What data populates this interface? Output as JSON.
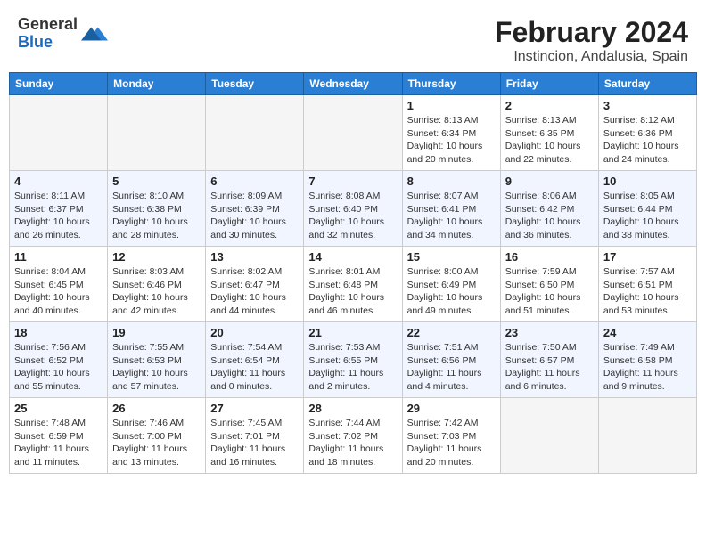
{
  "header": {
    "logo_general": "General",
    "logo_blue": "Blue",
    "title": "February 2024",
    "subtitle": "Instincion, Andalusia, Spain"
  },
  "days_of_week": [
    "Sunday",
    "Monday",
    "Tuesday",
    "Wednesday",
    "Thursday",
    "Friday",
    "Saturday"
  ],
  "weeks": [
    {
      "alt": false,
      "days": [
        {
          "num": "",
          "info": ""
        },
        {
          "num": "",
          "info": ""
        },
        {
          "num": "",
          "info": ""
        },
        {
          "num": "",
          "info": ""
        },
        {
          "num": "1",
          "info": "Sunrise: 8:13 AM\nSunset: 6:34 PM\nDaylight: 10 hours\nand 20 minutes."
        },
        {
          "num": "2",
          "info": "Sunrise: 8:13 AM\nSunset: 6:35 PM\nDaylight: 10 hours\nand 22 minutes."
        },
        {
          "num": "3",
          "info": "Sunrise: 8:12 AM\nSunset: 6:36 PM\nDaylight: 10 hours\nand 24 minutes."
        }
      ]
    },
    {
      "alt": true,
      "days": [
        {
          "num": "4",
          "info": "Sunrise: 8:11 AM\nSunset: 6:37 PM\nDaylight: 10 hours\nand 26 minutes."
        },
        {
          "num": "5",
          "info": "Sunrise: 8:10 AM\nSunset: 6:38 PM\nDaylight: 10 hours\nand 28 minutes."
        },
        {
          "num": "6",
          "info": "Sunrise: 8:09 AM\nSunset: 6:39 PM\nDaylight: 10 hours\nand 30 minutes."
        },
        {
          "num": "7",
          "info": "Sunrise: 8:08 AM\nSunset: 6:40 PM\nDaylight: 10 hours\nand 32 minutes."
        },
        {
          "num": "8",
          "info": "Sunrise: 8:07 AM\nSunset: 6:41 PM\nDaylight: 10 hours\nand 34 minutes."
        },
        {
          "num": "9",
          "info": "Sunrise: 8:06 AM\nSunset: 6:42 PM\nDaylight: 10 hours\nand 36 minutes."
        },
        {
          "num": "10",
          "info": "Sunrise: 8:05 AM\nSunset: 6:44 PM\nDaylight: 10 hours\nand 38 minutes."
        }
      ]
    },
    {
      "alt": false,
      "days": [
        {
          "num": "11",
          "info": "Sunrise: 8:04 AM\nSunset: 6:45 PM\nDaylight: 10 hours\nand 40 minutes."
        },
        {
          "num": "12",
          "info": "Sunrise: 8:03 AM\nSunset: 6:46 PM\nDaylight: 10 hours\nand 42 minutes."
        },
        {
          "num": "13",
          "info": "Sunrise: 8:02 AM\nSunset: 6:47 PM\nDaylight: 10 hours\nand 44 minutes."
        },
        {
          "num": "14",
          "info": "Sunrise: 8:01 AM\nSunset: 6:48 PM\nDaylight: 10 hours\nand 46 minutes."
        },
        {
          "num": "15",
          "info": "Sunrise: 8:00 AM\nSunset: 6:49 PM\nDaylight: 10 hours\nand 49 minutes."
        },
        {
          "num": "16",
          "info": "Sunrise: 7:59 AM\nSunset: 6:50 PM\nDaylight: 10 hours\nand 51 minutes."
        },
        {
          "num": "17",
          "info": "Sunrise: 7:57 AM\nSunset: 6:51 PM\nDaylight: 10 hours\nand 53 minutes."
        }
      ]
    },
    {
      "alt": true,
      "days": [
        {
          "num": "18",
          "info": "Sunrise: 7:56 AM\nSunset: 6:52 PM\nDaylight: 10 hours\nand 55 minutes."
        },
        {
          "num": "19",
          "info": "Sunrise: 7:55 AM\nSunset: 6:53 PM\nDaylight: 10 hours\nand 57 minutes."
        },
        {
          "num": "20",
          "info": "Sunrise: 7:54 AM\nSunset: 6:54 PM\nDaylight: 11 hours\nand 0 minutes."
        },
        {
          "num": "21",
          "info": "Sunrise: 7:53 AM\nSunset: 6:55 PM\nDaylight: 11 hours\nand 2 minutes."
        },
        {
          "num": "22",
          "info": "Sunrise: 7:51 AM\nSunset: 6:56 PM\nDaylight: 11 hours\nand 4 minutes."
        },
        {
          "num": "23",
          "info": "Sunrise: 7:50 AM\nSunset: 6:57 PM\nDaylight: 11 hours\nand 6 minutes."
        },
        {
          "num": "24",
          "info": "Sunrise: 7:49 AM\nSunset: 6:58 PM\nDaylight: 11 hours\nand 9 minutes."
        }
      ]
    },
    {
      "alt": false,
      "days": [
        {
          "num": "25",
          "info": "Sunrise: 7:48 AM\nSunset: 6:59 PM\nDaylight: 11 hours\nand 11 minutes."
        },
        {
          "num": "26",
          "info": "Sunrise: 7:46 AM\nSunset: 7:00 PM\nDaylight: 11 hours\nand 13 minutes."
        },
        {
          "num": "27",
          "info": "Sunrise: 7:45 AM\nSunset: 7:01 PM\nDaylight: 11 hours\nand 16 minutes."
        },
        {
          "num": "28",
          "info": "Sunrise: 7:44 AM\nSunset: 7:02 PM\nDaylight: 11 hours\nand 18 minutes."
        },
        {
          "num": "29",
          "info": "Sunrise: 7:42 AM\nSunset: 7:03 PM\nDaylight: 11 hours\nand 20 minutes."
        },
        {
          "num": "",
          "info": ""
        },
        {
          "num": "",
          "info": ""
        }
      ]
    }
  ]
}
